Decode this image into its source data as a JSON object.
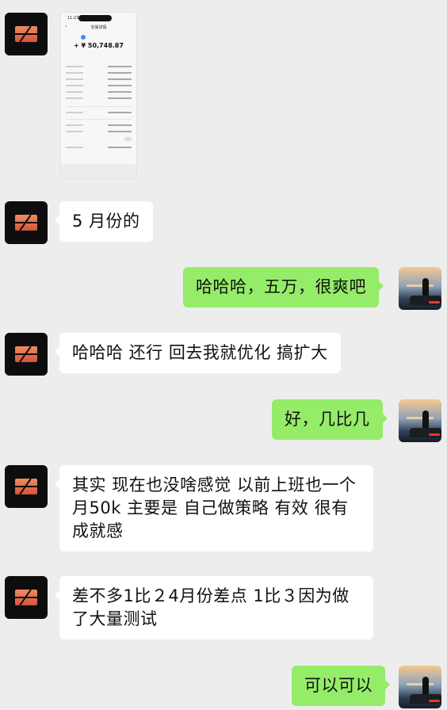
{
  "thumbnail": {
    "time": "11:23",
    "nav_title": "交易详情",
    "amount": "+ ¥ 50,748.87"
  },
  "messages": [
    {
      "side": "left",
      "text": "5 月份的"
    },
    {
      "side": "right",
      "text": "哈哈哈，五万，很爽吧"
    },
    {
      "side": "left",
      "text": "哈哈哈 还行 回去我就优化 搞扩大"
    },
    {
      "side": "right",
      "text": "好，几比几"
    },
    {
      "side": "left",
      "text": "其实 现在也没啥感觉 以前上班也一个月50k  主要是 自己做策略 有效 很有成就感"
    },
    {
      "side": "left",
      "text": "差不多1比２4月份差点 1比３因为做了大量测试"
    },
    {
      "side": "right",
      "text": "可以可以"
    }
  ]
}
